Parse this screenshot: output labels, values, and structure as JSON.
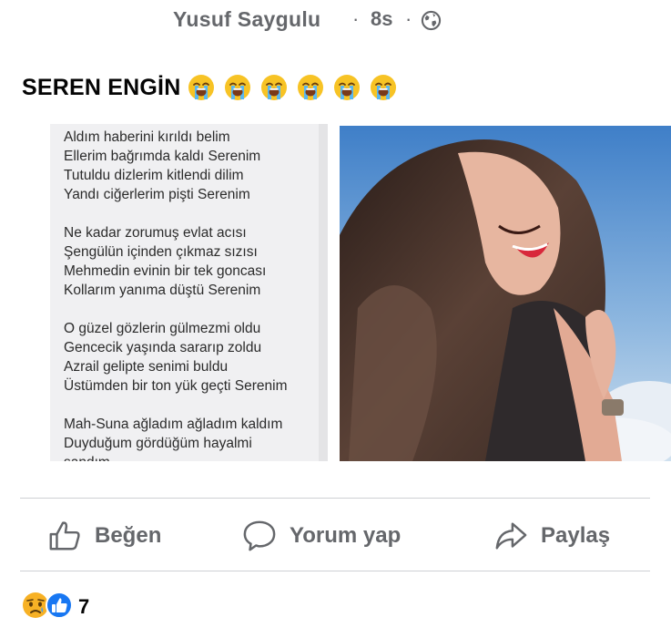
{
  "post": {
    "author": "Yusuf Saygulu",
    "separator": "·",
    "time": "8s",
    "privacy_icon": "globe-icon",
    "title": "SEREN ENGİN",
    "title_emojis": [
      "loudly-crying-face",
      "loudly-crying-face",
      "loudly-crying-face",
      "loudly-crying-face",
      "loudly-crying-face",
      "loudly-crying-face"
    ]
  },
  "poem": {
    "lines": [
      "Aldım haberini kırıldı belim",
      "Ellerim bağrımda kaldı Serenim",
      "Tutuldu dizlerim kitlendi dilim",
      "Yandı ciğerlerim pişti Serenim",
      "",
      "Ne kadar zorumuş evlat acısı",
      "Şengülün içinden çıkmaz sızısı",
      "Mehmedin evinin bir tek goncası",
      "Kollarım yanıma düştü Serenim",
      "",
      "O güzel gözlerin gülmezmi oldu",
      "Gencecik yaşında sararıp zoldu",
      "Azrail gelipte senimi buldu",
      "Üstümden bir ton yük geçti Serenim",
      "",
      "Mah-Suna ağladım ağladım kaldım",
      "Duyduğum gördüğüm hayalmi",
      "sandım"
    ]
  },
  "actions": {
    "like": {
      "label": "Beğen",
      "icon": "thumbs-up-icon"
    },
    "comment": {
      "label": "Yorum yap",
      "icon": "comment-bubble-icon"
    },
    "share": {
      "label": "Paylaş",
      "icon": "share-arrow-icon"
    }
  },
  "reactions": {
    "types": [
      "sad",
      "like"
    ],
    "count": "7"
  },
  "colors": {
    "meta_gray": "#65676b",
    "like_blue": "#1877f2",
    "sad_yellow": "#f7b125",
    "divider": "#ced0d4"
  }
}
